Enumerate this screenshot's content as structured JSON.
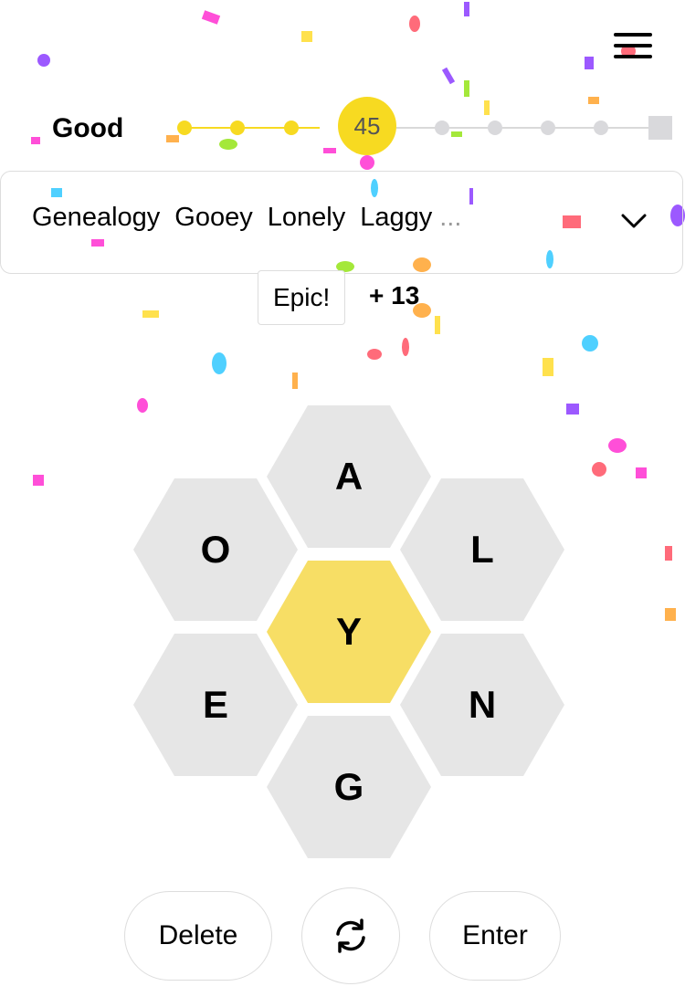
{
  "header": {
    "menu_icon": "hamburger-menu-icon"
  },
  "rank": {
    "label": "Good",
    "score": "45",
    "completed_levels": 3,
    "remaining_levels": 4
  },
  "found_words": {
    "words": [
      "Genealogy",
      "Gooey",
      "Lonely",
      "Laggy"
    ],
    "more": "...",
    "expand_icon": "chevron-down-icon"
  },
  "feedback": {
    "message": "Epic!",
    "points": "+ 13"
  },
  "hive": {
    "center": "Y",
    "outer": {
      "top": "A",
      "upper_left": "O",
      "upper_right": "L",
      "lower_left": "E",
      "lower_right": "N",
      "bottom": "G"
    },
    "center_color": "#f7da21",
    "outer_color": "#e6e6e6"
  },
  "controls": {
    "delete_label": "Delete",
    "shuffle_icon": "shuffle-icon",
    "enter_label": "Enter"
  }
}
